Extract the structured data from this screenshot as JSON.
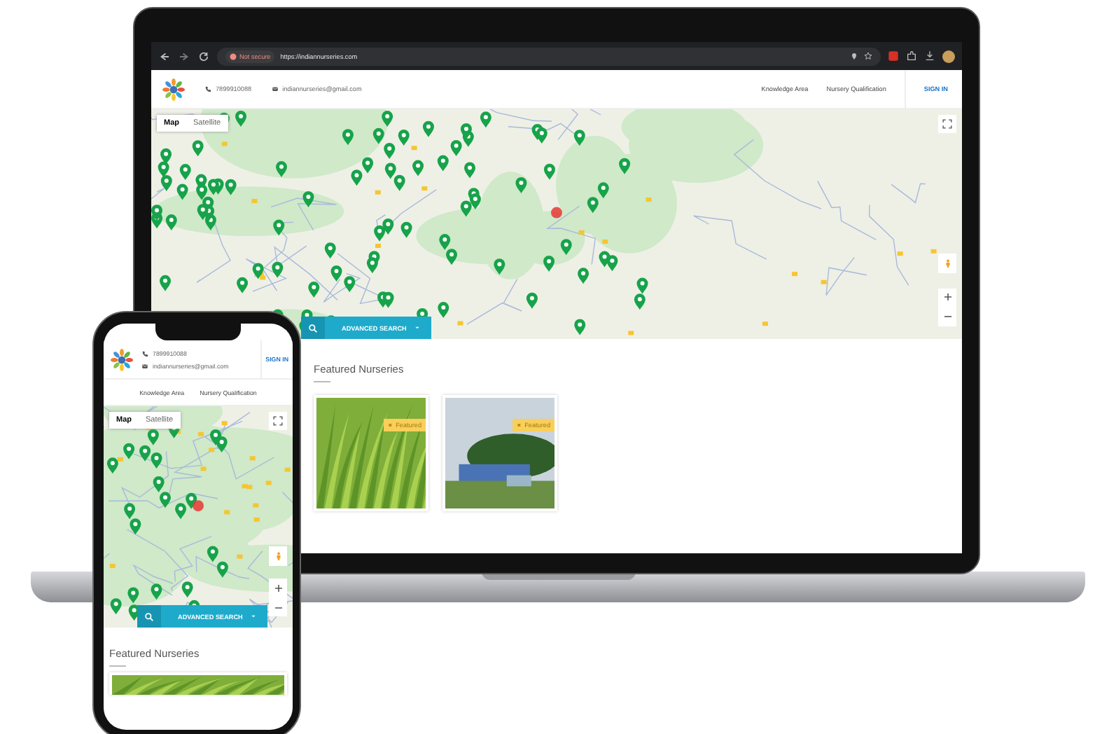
{
  "browser": {
    "security": "Not secure",
    "url": "https://indiannurseries.com"
  },
  "laptop_site": {
    "header": {
      "phone": "7899910088",
      "email": "indiannurseries@gmail.com",
      "nav": [
        {
          "label": "Knowledge Area"
        },
        {
          "label": "Nursery Qualification"
        }
      ],
      "sign_in": "SIGN IN"
    },
    "map": {
      "tabs": [
        {
          "label": "Map",
          "selected": true
        },
        {
          "label": "Satellite",
          "selected": false
        }
      ]
    },
    "search_button": "ADVANCED SEARCH",
    "section_title": "Featured Nurseries",
    "cards": [
      {
        "kind": "plants",
        "badge": "Featured"
      },
      {
        "kind": "building",
        "badge": "Featured"
      }
    ]
  },
  "phone_site": {
    "header": {
      "phone": "7899910088",
      "email": "indiannurseries@gmail.com",
      "nav": [
        {
          "label": "Knowledge Area"
        },
        {
          "label": "Nursery Qualification"
        }
      ],
      "sign_in": "SIGN IN"
    },
    "map": {
      "tabs": [
        {
          "label": "Map",
          "selected": true
        },
        {
          "label": "Satellite",
          "selected": false
        }
      ]
    },
    "search_button": "ADVANCED SEARCH",
    "section_title": "Featured Nurseries",
    "cards": [
      {
        "kind": "plants"
      }
    ]
  }
}
